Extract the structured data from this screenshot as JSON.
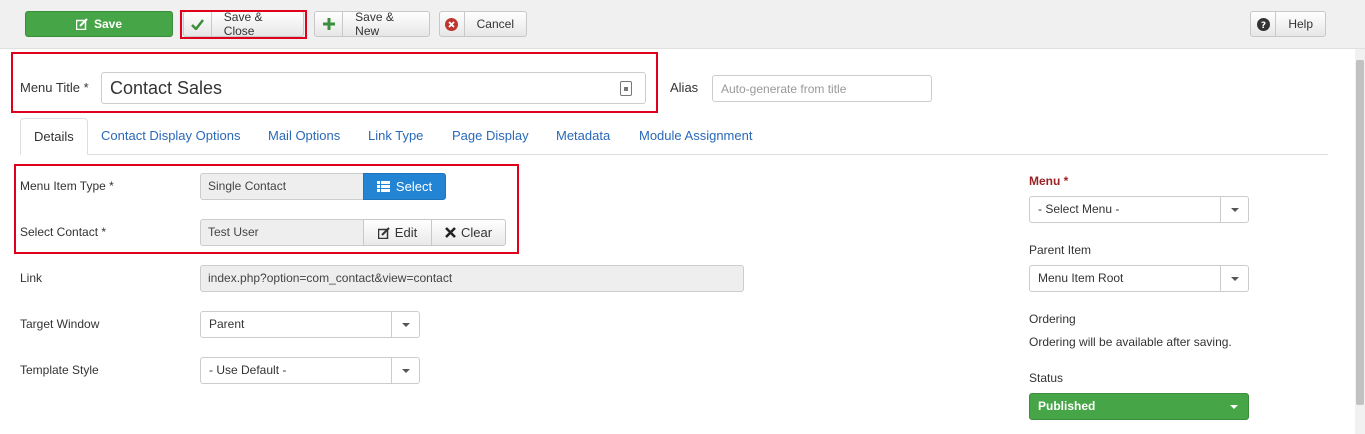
{
  "toolbar": {
    "save": "Save",
    "save_close": "Save & Close",
    "save_new": "Save & New",
    "cancel": "Cancel",
    "help": "Help"
  },
  "title_row": {
    "menu_title_label": "Menu Title *",
    "menu_title_value": "Contact Sales",
    "alias_label": "Alias",
    "alias_placeholder": "Auto-generate from title"
  },
  "tabs": [
    {
      "label": "Details"
    },
    {
      "label": "Contact Display Options"
    },
    {
      "label": "Mail Options"
    },
    {
      "label": "Link Type"
    },
    {
      "label": "Page Display"
    },
    {
      "label": "Metadata"
    },
    {
      "label": "Module Assignment"
    }
  ],
  "details": {
    "menu_item_type_label": "Menu Item Type *",
    "menu_item_type_value": "Single Contact",
    "select_button": "Select",
    "select_contact_label": "Select Contact *",
    "select_contact_value": "Test User",
    "edit_button": "Edit",
    "clear_button": "Clear",
    "link_label": "Link",
    "link_value": "index.php?option=com_contact&view=contact",
    "target_window_label": "Target Window",
    "target_window_value": "Parent",
    "template_style_label": "Template Style",
    "template_style_value": "- Use Default -"
  },
  "sidebar": {
    "menu_label": "Menu *",
    "menu_value": "- Select Menu -",
    "parent_item_label": "Parent Item",
    "parent_item_value": "Menu Item Root",
    "ordering_label": "Ordering",
    "ordering_note": "Ordering will be available after saving.",
    "status_label": "Status",
    "status_value": "Published"
  },
  "colors": {
    "save_green": "#46a546",
    "select_blue": "#2384d3",
    "highlight_red": "#e0001b",
    "link_blue": "#2a69b8",
    "required_red": "#9b2227"
  }
}
